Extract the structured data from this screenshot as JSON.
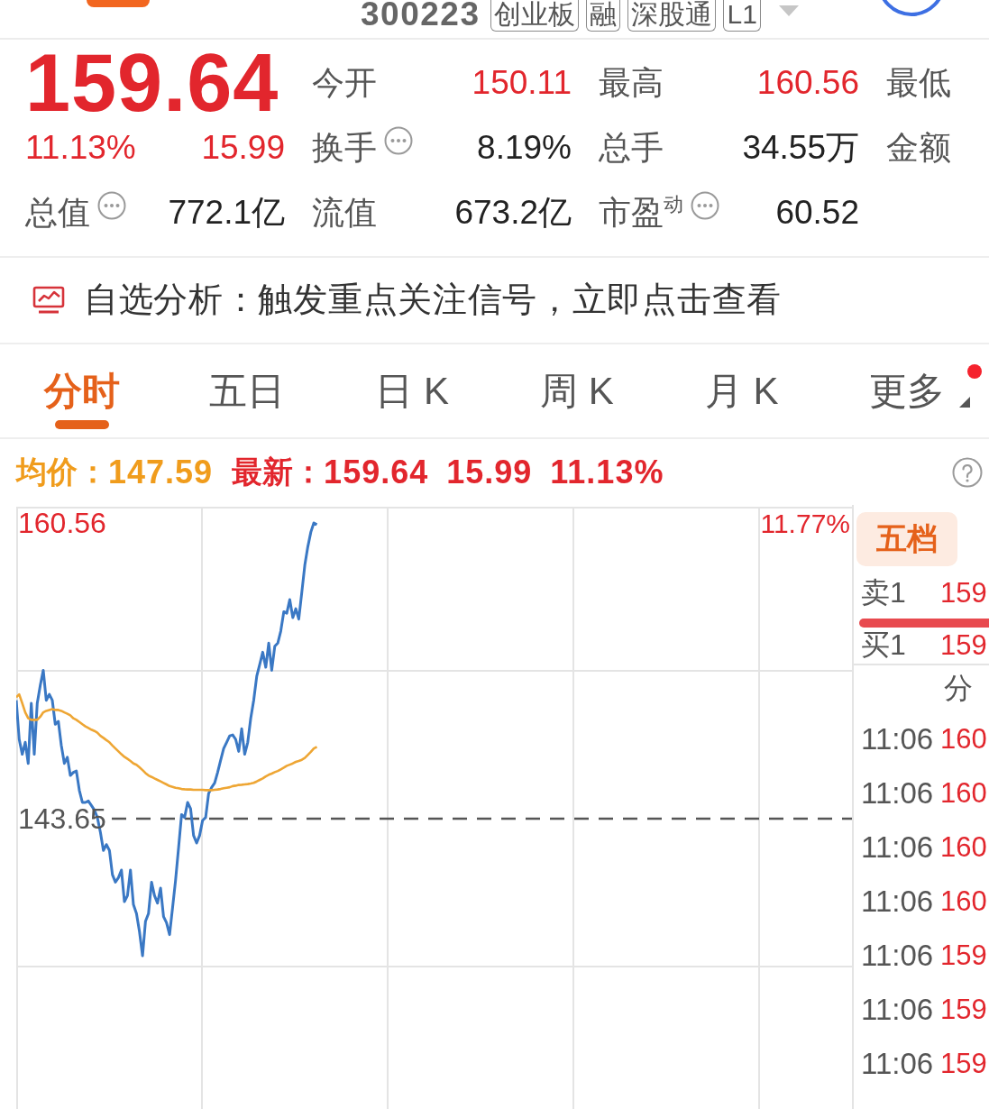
{
  "header": {
    "code": "300223",
    "tags": [
      "创业板",
      "融",
      "深股通",
      "L1"
    ]
  },
  "quote": {
    "price": "159.64",
    "change_pct": "11.13%",
    "change": "15.99",
    "stats": [
      {
        "label": "今开",
        "info": false,
        "value": "150.11",
        "color": "#e2262d"
      },
      {
        "label": "最高",
        "info": false,
        "value": "160.56",
        "color": "#e2262d"
      },
      {
        "label": "最低",
        "info": false
      },
      {
        "label": "换手",
        "info": true,
        "value": "8.19%",
        "color": "#222222"
      },
      {
        "label": "总手",
        "info": false,
        "value": "34.55万",
        "color": "#222222"
      },
      {
        "label": "金额",
        "info": false
      },
      {
        "label": "总值",
        "info": true,
        "value": "772.1亿",
        "color": "#222222"
      },
      {
        "label": "流值",
        "info": false,
        "value": "673.2亿",
        "color": "#222222"
      },
      {
        "label": "市盈$^{动}$",
        "info": true,
        "value": "60.52",
        "color": "#222222"
      }
    ]
  },
  "banner": {
    "text": "自选分析：触发重点关注信号，立即点击查看"
  },
  "tabs": [
    {
      "label": "分时",
      "selected": true,
      "dot": false,
      "dropdown": false
    },
    {
      "label": "五日",
      "selected": false,
      "dot": false,
      "dropdown": false
    },
    {
      "label": "日 K",
      "selected": false,
      "dot": false,
      "dropdown": false
    },
    {
      "label": "周 K",
      "selected": false,
      "dot": false,
      "dropdown": false
    },
    {
      "label": "月 K",
      "selected": false,
      "dot": false,
      "dropdown": false
    },
    {
      "label": "更多",
      "selected": false,
      "dot": true,
      "dropdown": true
    }
  ],
  "info_bar": {
    "avg_label": "均价：",
    "avg": "147.59",
    "last_label": "最新：",
    "last": "159.64",
    "change": "15.99",
    "change_pct": "11.13%"
  },
  "chart": {
    "pct_label": "11.77%",
    "chart_data": {
      "type": "line",
      "categories": [
        null,
        null,
        null,
        null,
        null,
        null,
        null,
        null,
        null,
        null,
        null,
        null,
        null,
        null,
        null,
        null,
        null,
        null,
        null,
        null,
        null,
        null,
        null,
        null,
        null,
        null,
        null,
        null,
        null,
        null,
        null,
        null,
        null,
        null,
        null,
        null,
        null,
        null,
        null,
        null,
        null,
        null,
        null,
        null,
        null,
        null,
        null,
        null,
        null,
        null,
        null,
        null,
        null,
        null,
        null,
        null,
        null,
        null,
        null,
        null,
        null,
        null,
        null,
        null,
        null,
        null,
        null,
        null,
        null,
        null,
        null,
        null,
        null,
        null,
        null,
        null,
        null,
        null,
        null,
        null,
        null,
        null,
        null,
        null,
        null,
        null,
        null,
        null,
        null,
        null,
        null,
        null,
        null,
        null,
        null,
        null,
        null,
        null,
        null,
        null,
        null,
        null,
        null,
        null,
        null,
        null,
        null,
        null,
        null,
        null,
        null,
        null,
        null,
        null,
        null,
        null,
        null,
        null,
        null,
        null,
        null,
        null,
        null,
        null,
        null,
        null,
        null,
        null,
        null,
        null,
        null,
        null,
        null,
        null,
        null,
        null,
        null,
        null,
        null,
        null,
        null,
        null,
        null,
        null,
        null,
        null,
        null,
        null,
        null,
        null,
        null,
        null,
        null,
        null,
        null,
        null,
        null,
        null,
        null,
        null,
        null,
        null,
        null,
        null,
        null,
        null,
        null,
        null,
        null,
        null,
        null,
        null,
        null,
        null,
        null,
        null,
        null,
        null,
        null,
        null,
        null,
        null,
        null,
        null,
        null,
        null,
        null,
        null,
        null,
        null,
        null,
        null,
        null,
        null,
        null,
        null,
        null,
        null,
        null,
        null,
        null,
        null,
        null,
        null,
        null,
        null,
        null,
        null,
        null,
        null,
        null,
        null,
        null,
        null,
        null,
        null,
        null,
        null,
        null,
        null,
        null,
        null,
        null,
        null,
        null,
        null,
        null,
        null,
        null,
        null,
        null,
        null,
        null,
        null,
        null,
        null,
        null,
        null,
        null,
        null,
        null,
        null,
        null,
        null,
        null,
        null,
        null,
        null,
        null,
        null,
        null,
        null,
        null,
        null,
        null,
        null,
        null,
        null,
        null,
        null,
        null,
        null,
        null,
        null,
        null,
        null,
        null,
        null,
        null,
        null,
        null,
        null,
        null,
        null,
        null,
        null,
        null,
        null,
        null
      ],
      "ylim": [
        127.05,
        161.49
      ],
      "yticks": [
        {
          "value": 160.56,
          "label": "160.56"
        },
        {
          "value": 143.65,
          "label": "143.65"
        }
      ],
      "ref_lines": [
        {
          "axis": "y",
          "value": 143.65
        }
      ],
      "series": [
        {
          "color": "#3a78c4",
          "values": [
            150.42,
            148.19,
            147.33,
            148.02,
            146.81,
            150.25,
            147.33,
            150.25,
            151.28,
            152.14,
            150.42,
            150.76,
            150.42,
            149.05,
            149.22,
            147.84,
            146.81,
            147.16,
            146.12,
            146.3,
            146.38,
            145.27,
            144.58,
            144.58,
            144.66,
            144.41,
            144.15,
            143.72,
            142.86,
            141.83,
            142.17,
            141.83,
            140.45,
            140.02,
            140.28,
            140.71,
            138.91,
            139.25,
            140.71,
            138.74,
            138.22,
            137.19,
            135.81,
            137.79,
            138.22,
            140.02,
            139.25,
            138.82,
            139.68,
            138.05,
            137.7,
            137.02,
            138.56,
            140.11,
            142.0,
            143.89,
            143.72,
            144.58,
            144.23,
            142.69,
            142.26,
            142.69,
            143.55,
            143.72,
            145.09,
            145.44,
            145.7,
            146.3,
            146.98,
            147.67,
            148.02,
            148.39,
            148.44,
            148.19,
            147.5,
            148.79,
            147.33,
            148.02,
            149.39,
            150.42,
            151.8,
            152.48,
            153.17,
            152.31,
            153.69,
            152.14,
            153.51,
            153.69,
            154.37,
            155.49,
            155.4,
            156.18,
            155.15,
            155.66,
            155.06,
            156.61,
            158.15,
            159.19,
            160.04,
            160.56,
            160.47,
            null,
            null,
            null,
            null,
            null,
            null,
            null,
            null,
            null,
            null,
            null,
            null,
            null,
            null,
            null,
            null,
            null,
            null,
            null,
            null,
            null,
            null,
            null,
            null,
            null,
            null,
            null,
            null,
            null,
            null,
            null,
            null,
            null,
            null,
            null,
            null,
            null,
            null,
            null,
            null,
            null,
            null,
            null,
            null,
            null,
            null,
            null,
            null,
            null,
            null,
            null,
            null,
            null,
            null,
            null,
            null,
            null,
            null,
            null,
            null,
            null,
            null,
            null,
            null,
            null,
            null,
            null,
            null,
            null,
            null,
            null,
            null,
            null,
            null,
            null,
            null,
            null,
            null,
            null,
            null,
            null,
            null,
            null,
            null,
            null,
            null,
            null,
            null,
            null,
            null,
            null,
            null,
            null,
            null,
            null,
            null,
            null,
            null,
            null,
            null,
            null,
            null,
            null,
            null,
            null,
            null,
            null,
            null,
            null,
            null,
            null,
            null,
            null,
            null,
            null,
            null,
            null,
            null,
            null,
            null,
            null,
            null,
            null,
            null,
            null,
            null,
            null,
            null,
            null,
            null,
            null,
            null,
            null,
            null,
            null,
            null,
            null,
            null,
            null,
            null,
            null,
            null,
            null,
            null,
            null,
            null,
            null,
            null,
            null,
            null,
            null,
            null,
            null,
            null,
            null,
            null,
            null,
            null,
            null,
            null,
            null,
            null,
            null,
            null,
            null,
            null,
            null,
            null,
            null,
            null,
            null,
            null,
            null,
            null,
            null,
            null,
            null,
            null
          ]
        },
        {
          "color": "#eea634",
          "values": [
            150.59,
            150.76,
            150.25,
            149.73,
            149.39,
            149.3,
            149.3,
            149.3,
            149.48,
            149.73,
            149.82,
            149.87,
            149.91,
            149.87,
            149.87,
            149.82,
            149.73,
            149.65,
            149.56,
            149.39,
            149.3,
            149.18,
            149.05,
            148.93,
            148.84,
            148.74,
            148.67,
            148.57,
            148.39,
            148.27,
            148.14,
            148.02,
            147.84,
            147.67,
            147.5,
            147.33,
            147.19,
            147.07,
            146.95,
            146.81,
            146.73,
            146.59,
            146.43,
            146.26,
            146.12,
            146.04,
            145.95,
            145.87,
            145.78,
            145.7,
            145.61,
            145.52,
            145.47,
            145.42,
            145.39,
            145.35,
            145.33,
            145.32,
            145.32,
            145.3,
            145.3,
            145.3,
            145.3,
            145.28,
            145.28,
            145.28,
            145.3,
            145.32,
            145.35,
            145.39,
            145.42,
            145.45,
            145.51,
            145.54,
            145.58,
            145.59,
            145.61,
            145.63,
            145.66,
            145.7,
            145.78,
            145.87,
            145.95,
            146.07,
            146.16,
            146.23,
            146.31,
            146.38,
            146.47,
            146.57,
            146.67,
            146.74,
            146.81,
            146.9,
            146.95,
            147.02,
            147.12,
            147.29,
            147.47,
            147.67,
            147.76,
            null,
            null,
            null,
            null,
            null,
            null,
            null,
            null,
            null,
            null,
            null,
            null,
            null,
            null,
            null,
            null,
            null,
            null,
            null,
            null,
            null,
            null,
            null,
            null,
            null,
            null,
            null,
            null,
            null,
            null,
            null,
            null,
            null,
            null,
            null,
            null,
            null,
            null,
            null,
            null,
            null,
            null,
            null,
            null,
            null,
            null,
            null,
            null,
            null,
            null,
            null,
            null,
            null,
            null,
            null,
            null,
            null,
            null,
            null,
            null,
            null,
            null,
            null,
            null,
            null,
            null,
            null,
            null,
            null,
            null,
            null,
            null,
            null,
            null,
            null,
            null,
            null,
            null,
            null,
            null,
            null,
            null,
            null,
            null,
            null,
            null,
            null,
            null,
            null,
            null,
            null,
            null,
            null,
            null,
            null,
            null,
            null,
            null,
            null,
            null,
            null,
            null,
            null,
            null,
            null,
            null,
            null,
            null,
            null,
            null,
            null,
            null,
            null,
            null,
            null,
            null,
            null,
            null,
            null,
            null,
            null,
            null,
            null,
            null,
            null,
            null,
            null,
            null,
            null,
            null,
            null,
            null,
            null,
            null,
            null,
            null,
            null,
            null,
            null,
            null,
            null,
            null,
            null,
            null,
            null,
            null,
            null,
            null,
            null,
            null,
            null,
            null,
            null,
            null,
            null,
            null,
            null,
            null,
            null,
            null,
            null,
            null,
            null,
            null,
            null,
            null,
            null,
            null,
            null,
            null,
            null,
            null,
            null,
            null,
            null,
            null,
            null,
            null
          ]
        }
      ]
    }
  },
  "depth_panel": {
    "tabs": [
      {
        "label": "五档",
        "selected": true
      }
    ],
    "quotes": [
      {
        "label": "卖1",
        "price": "159"
      },
      {
        "label": "买1",
        "price": "159"
      }
    ],
    "ticks_header": "分",
    "ticks": [
      {
        "time": "11:06",
        "price": "160"
      },
      {
        "time": "11:06",
        "price": "160"
      },
      {
        "time": "11:06",
        "price": "160"
      },
      {
        "time": "11:06",
        "price": "160"
      },
      {
        "time": "11:06",
        "price": "159"
      },
      {
        "time": "11:06",
        "price": "159"
      },
      {
        "time": "11:06",
        "price": "159"
      }
    ]
  }
}
